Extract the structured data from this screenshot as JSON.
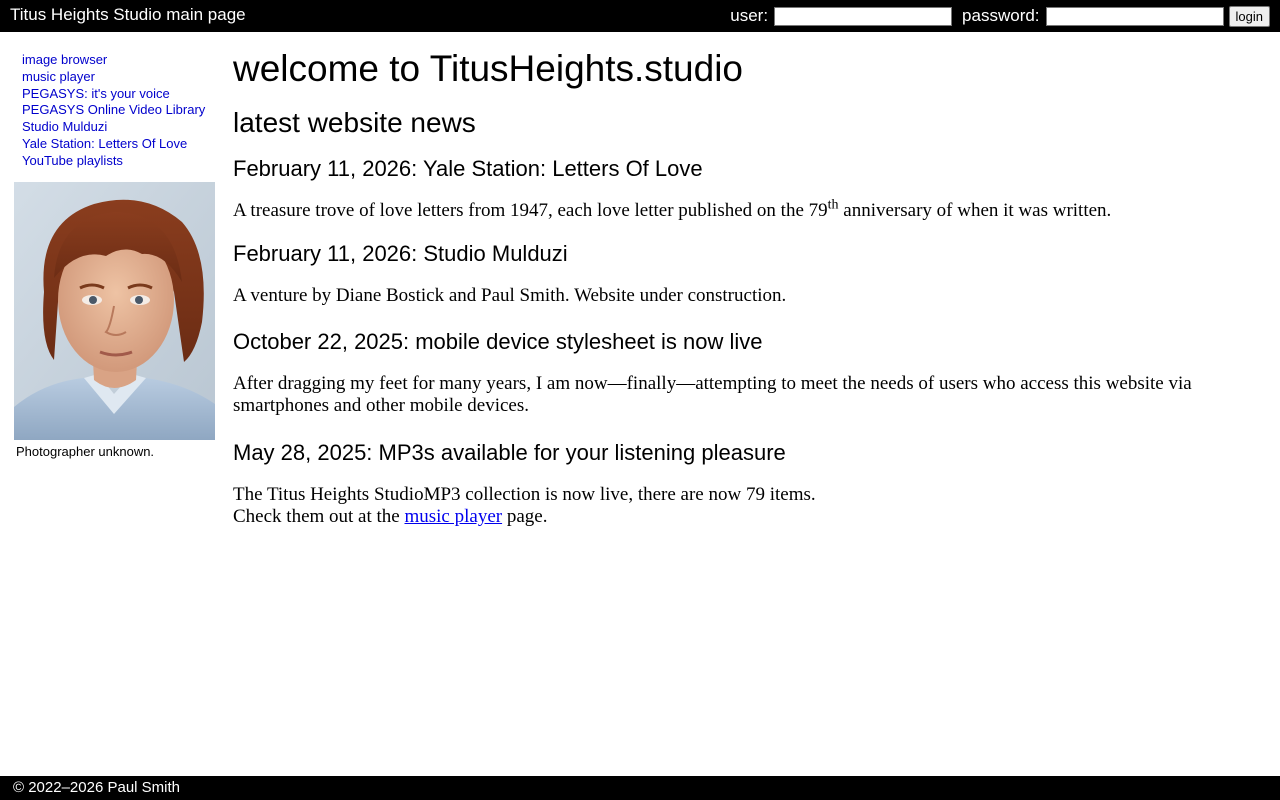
{
  "header": {
    "site_title": "Titus Heights Studio main page",
    "user_label": "user:",
    "user_value": "",
    "password_label": "password:",
    "password_value": "",
    "login_label": "login"
  },
  "sidebar": {
    "nav_items": [
      {
        "label": "image browser"
      },
      {
        "label": "music player"
      },
      {
        "label": "PEGASYS: it's your voice"
      },
      {
        "label": "PEGASYS Online Video Library"
      },
      {
        "label": "Studio Mulduzi"
      },
      {
        "label": "Yale Station: Letters Of Love"
      },
      {
        "label": "YouTube playlists"
      }
    ],
    "photo_caption": "Photographer unknown."
  },
  "main": {
    "title": "welcome to TitusHeights.studio",
    "section_heading": "latest website news",
    "news": [
      {
        "heading": "February 11, 2026: Yale Station: Letters Of Love",
        "body_before_sup": "A treasure trove of love letters from 1947, each love letter published on the 79",
        "body_sup": "th",
        "body_after_sup": " anniversary of when it was written."
      },
      {
        "heading": "February 11, 2026: Studio Mulduzi",
        "body": "A venture by Diane Bostick and Paul Smith. Website under construction."
      },
      {
        "heading": "October 22, 2025: mobile device stylesheet is now live",
        "body": "After dragging my feet for many years, I am now—finally—attempting to meet the needs of users who access this website via smartphones and other mobile devices."
      },
      {
        "heading": "May 28, 2025: MP3s available for your listening pleasure",
        "body_line1": "The Titus Heights StudioMP3 collection is now live, there are now 79 items.",
        "body_line2_before_link": "Check them out at the ",
        "body_line2_link": "music player",
        "body_line2_after_link": " page."
      }
    ]
  },
  "footer": {
    "copyright": "© 2022–2026 Paul Smith"
  },
  "colors": {
    "bar_background": "#000000",
    "nav_link": "#0000cc",
    "body_link": "#0000ee"
  }
}
